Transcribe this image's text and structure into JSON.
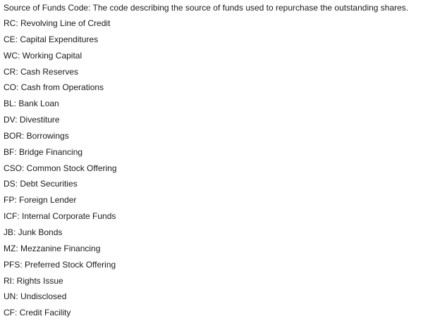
{
  "heading": "Source of Funds Code: The code describing the source of funds used to repurchase the outstanding shares.",
  "codes": [
    "RC: Revolving Line of Credit",
    "CE: Capital Expenditures",
    "WC: Working Capital",
    "CR: Cash Reserves",
    "CO: Cash from Operations",
    "BL: Bank Loan",
    "DV: Divestiture",
    "BOR: Borrowings",
    "BF: Bridge Financing",
    "CSO: Common Stock Offering",
    "DS: Debt Securities",
    "FP: Foreign Lender",
    "ICF: Internal Corporate Funds",
    "JB: Junk Bonds",
    "MZ: Mezzanine Financing",
    "PFS: Preferred Stock Offering",
    "RI: Rights Issue",
    "UN: Undisclosed",
    "CF: Credit Facility"
  ]
}
